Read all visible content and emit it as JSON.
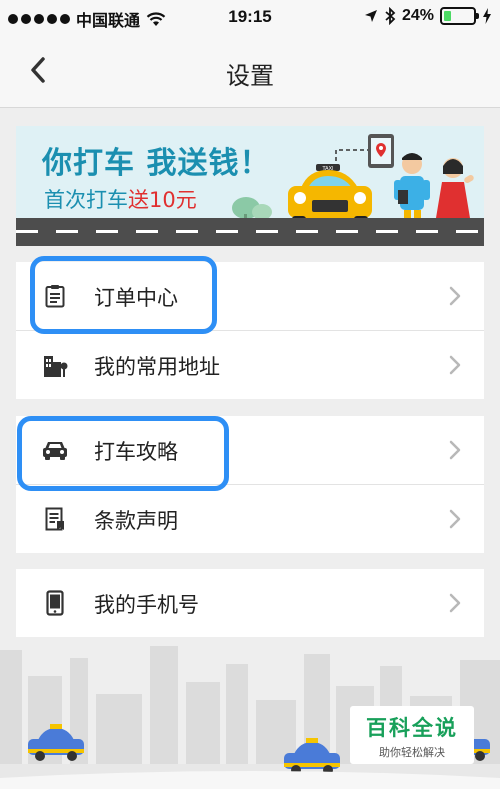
{
  "status_bar": {
    "carrier": "中国联通",
    "time": "19:15",
    "battery": "24%",
    "battery_level": 0.24
  },
  "nav": {
    "title": "设置",
    "back_icon": "chevron-left-icon"
  },
  "banner": {
    "line1": "你打车 我送钱！",
    "line2_prefix": "首次打车",
    "line2_highlight": "送10元",
    "taxi_sign": "TAXI"
  },
  "menu": {
    "group1": [
      {
        "label": "订单中心",
        "icon": "clipboard-icon",
        "highlighted": true
      },
      {
        "label": "我的常用地址",
        "icon": "building-icon",
        "highlighted": false
      }
    ],
    "group2": [
      {
        "label": "打车攻略",
        "icon": "car-icon",
        "highlighted": true
      },
      {
        "label": "条款声明",
        "icon": "document-icon",
        "highlighted": false
      }
    ],
    "group3": [
      {
        "label": "我的手机号",
        "icon": "phone-icon",
        "highlighted": false
      }
    ]
  },
  "watermark": {
    "title": "百科全说",
    "subtitle": "助你轻松解决"
  },
  "colors": {
    "highlight": "#2e8ff5",
    "banner_text": "#1b8fb0",
    "banner_red": "#e03030",
    "watermark_green": "#18a05a"
  }
}
